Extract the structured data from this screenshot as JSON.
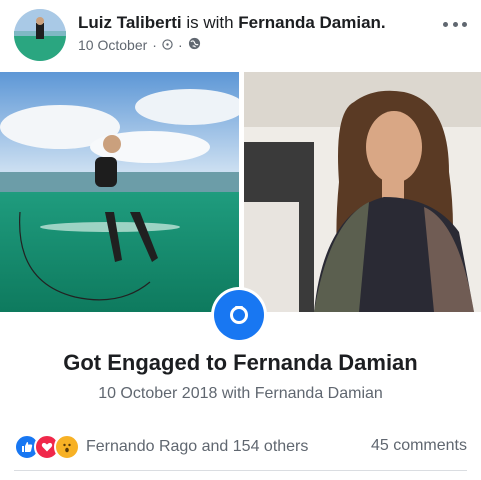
{
  "post": {
    "author": "Luiz Taliberti",
    "with_text": "is with",
    "tagged": "Fernanda Damian.",
    "date": "10 October",
    "sep": "·",
    "more_icon": "ellipsis-horizontal-icon",
    "privacy_icon": "globe-icon"
  },
  "life_event": {
    "title": "Got Engaged to Fernanda Damian",
    "subtitle": "10 October 2018 with Fernanda Damian",
    "icon": "ring-icon",
    "accent": "#1877f2"
  },
  "reactions": {
    "icons": [
      "like-icon",
      "love-icon",
      "wow-icon"
    ],
    "summary": "Fernando Rago and 154 others",
    "comments": "45 comments"
  }
}
